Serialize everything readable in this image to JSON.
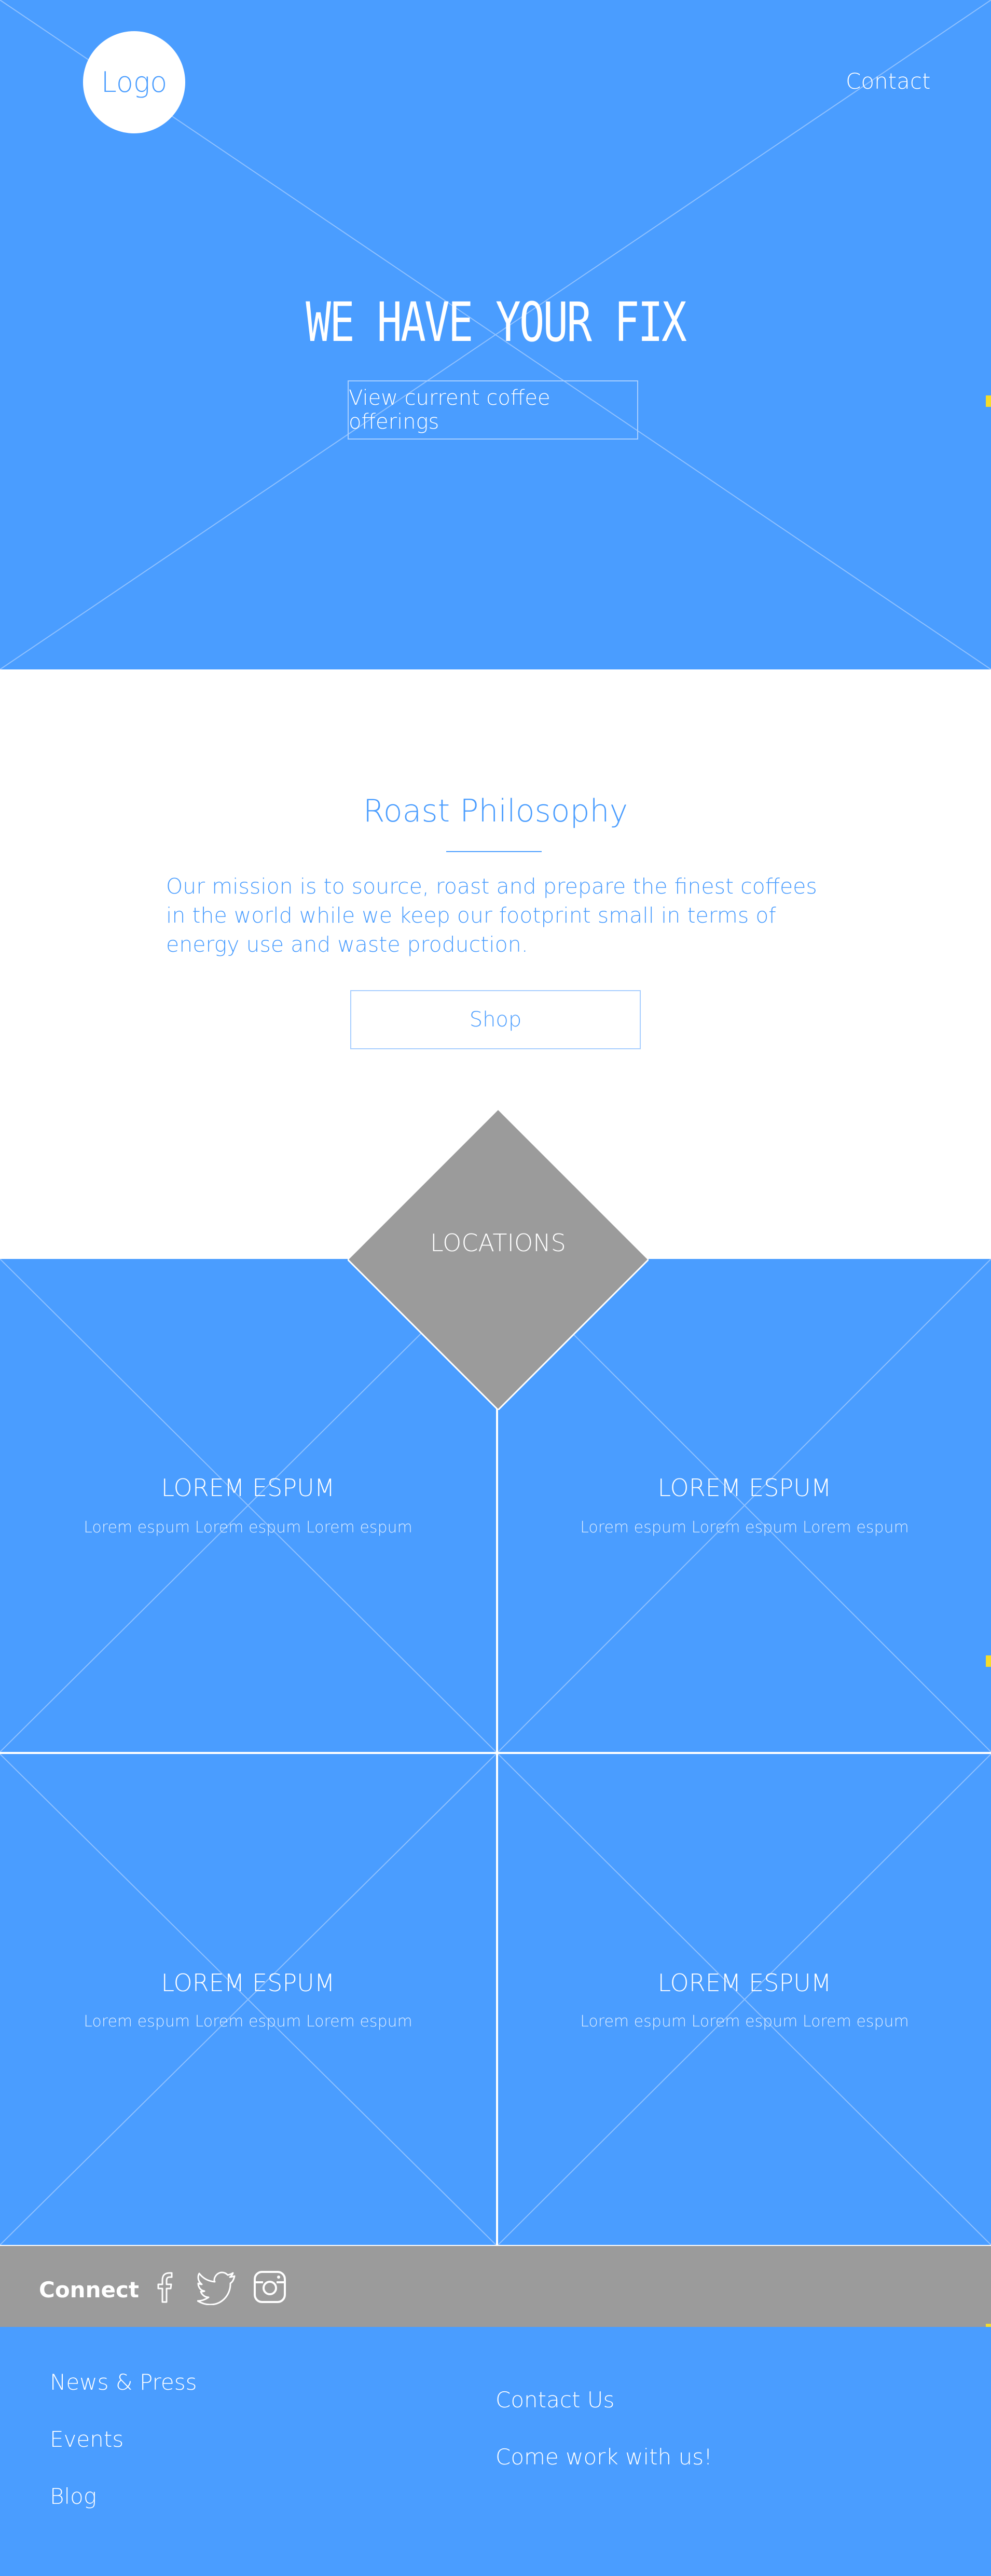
{
  "header": {
    "logo_text": "Logo",
    "contact_label": "Contact"
  },
  "hero": {
    "title": "WE HAVE YOUR FIX",
    "cta_label": "View current coffee offerings"
  },
  "philosophy": {
    "title": "Roast Philosophy",
    "body": "Our mission is to source, roast and prepare the finest coffees in the world while we keep our footprint small in terms of energy use and waste production.",
    "shop_label": "Shop"
  },
  "locations": {
    "label": "LOCATIONS",
    "tiles": [
      {
        "title": "LOREM ESPUM",
        "subtitle": "Lorem espum Lorem espum Lorem espum"
      },
      {
        "title": "LOREM ESPUM",
        "subtitle": "Lorem espum Lorem espum Lorem espum"
      },
      {
        "title": "LOREM ESPUM",
        "subtitle": "Lorem espum Lorem espum Lorem espum"
      },
      {
        "title": "LOREM ESPUM",
        "subtitle": "Lorem espum Lorem espum Lorem espum"
      }
    ]
  },
  "connect": {
    "label": "Connect",
    "icons": [
      "facebook-icon",
      "twitter-icon",
      "instagram-icon"
    ]
  },
  "footer": {
    "left_links": [
      "News & Press",
      "Events",
      "Blog"
    ],
    "right_links": [
      "Contact Us",
      "Come work with us!"
    ]
  },
  "colors": {
    "primary_blue": "#4a9dff",
    "gray": "#9b9b9b",
    "white": "#ffffff"
  }
}
